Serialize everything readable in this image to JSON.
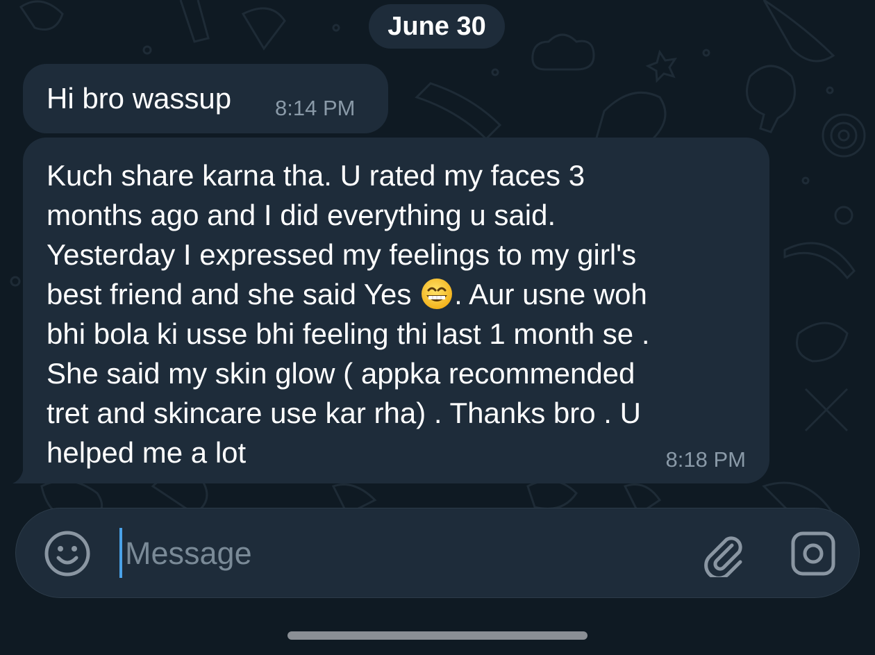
{
  "date_separator": "June 30",
  "messages": [
    {
      "text": "Hi bro wassup",
      "time": "8:14 PM"
    },
    {
      "text_before_emoji": "Kuch share karna tha. U rated my faces 3\nmonths ago and I did everything u said.\nYesterday I expressed my feelings to my girl's\nbest friend and she said Yes ",
      "emoji": "grinning-face-with-smiling-eyes",
      "text_after_emoji": ". Aur usne woh\nbhi bola ki usse bhi feeling thi last 1 month se .\nShe said my skin glow ( appka recommended\ntret and skincare use kar rha) . Thanks bro . U\nhelped me a lot",
      "time": "8:18 PM"
    }
  ],
  "composer": {
    "placeholder": "Message",
    "value": "",
    "icons": [
      "smile-icon",
      "paperclip-icon",
      "camera-icon"
    ]
  },
  "colors": {
    "background": "#0f1a23",
    "bubble": "#1e2c3a",
    "text": "#ffffff",
    "timestamp": "#8a9aa8",
    "cursor": "#4aa2e8",
    "placeholder": "#7a8a97"
  }
}
